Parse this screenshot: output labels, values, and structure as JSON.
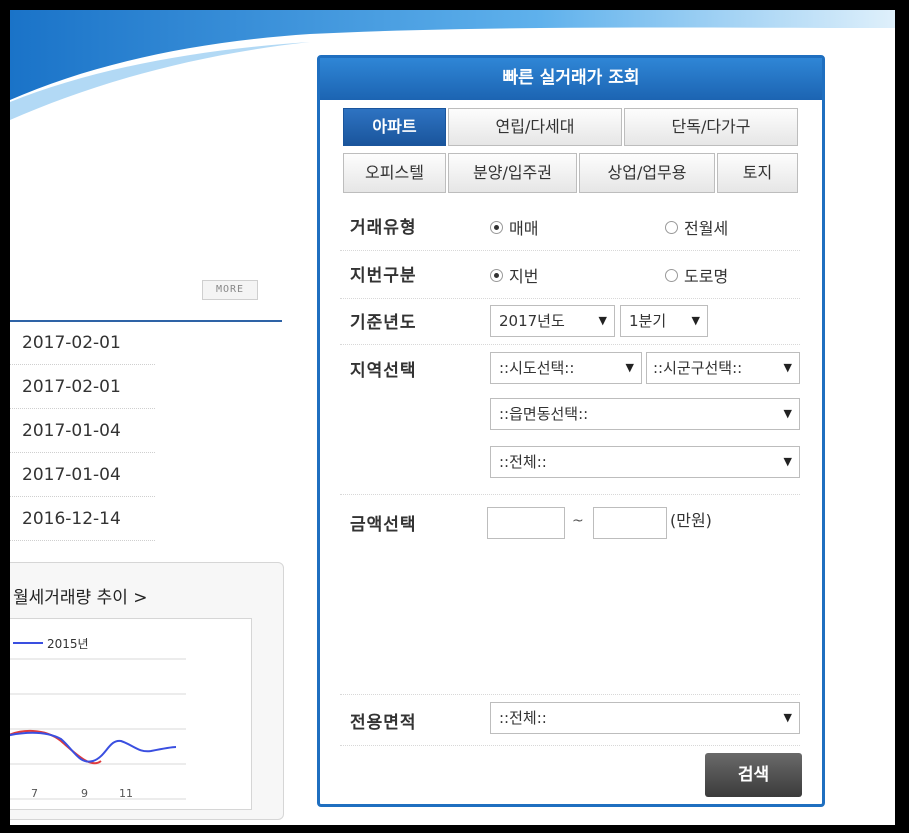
{
  "left": {
    "more_label": "MORE",
    "dates": [
      "2017-02-01",
      "2017-02-01",
      "2017-01-04",
      "2017-01-04",
      "2016-12-14"
    ],
    "trend": {
      "title": "월세거래량 추이 >",
      "legend": "2015년",
      "x_ticks": [
        "7",
        "9",
        "11"
      ],
      "series_colors": {
        "2015년": "#3a4fe0",
        "other": "#e03a3a"
      }
    }
  },
  "panel": {
    "title": "빠른 실거래가 조회",
    "tabs_row1": [
      "아파트",
      "연립/다세대",
      "단독/다가구"
    ],
    "tabs_row2": [
      "오피스텔",
      "분양/입주권",
      "상업/업무용",
      "토지"
    ],
    "active_tab": "아파트",
    "deal_type": {
      "label": "거래유형",
      "options": [
        "매매",
        "전월세"
      ],
      "selected": "매매"
    },
    "lot_type": {
      "label": "지번구분",
      "options": [
        "지번",
        "도로명"
      ],
      "selected": "지번"
    },
    "base_year": {
      "label": "기준년도",
      "year": "2017년도",
      "quarter": "1분기"
    },
    "region": {
      "label": "지역선택",
      "sido": "::시도선택::",
      "sigungu": "::시군구선택::",
      "eupmyeondong": "::읍면동선택::",
      "detail": "::전체::"
    },
    "amount": {
      "label": "금액선택",
      "min": "",
      "max": "",
      "separator": "~",
      "unit": "(만원)"
    },
    "area": {
      "label": "전용면적",
      "value": "::전체::"
    },
    "search_label": "검색"
  },
  "colors": {
    "accent": "#1f6fc0",
    "active_tab": "#2e73c2",
    "search_button": "#4a4a4a"
  }
}
